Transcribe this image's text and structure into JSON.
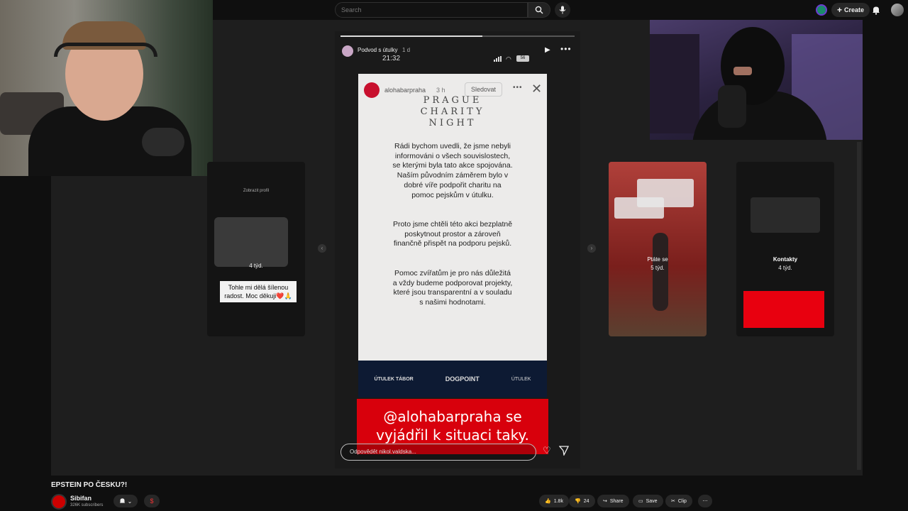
{
  "topbar": {
    "search_placeholder": "Search",
    "create_label": "Create"
  },
  "story": {
    "header_title": "Podvod s útulky",
    "header_age": "1 d",
    "time": "21:32",
    "battery": "56",
    "inner_account": "alohabarpraha",
    "inner_age": "3 h",
    "follow_label": "Sledovat",
    "heading_lines": [
      "PRAGUE",
      "CHARITY",
      "NIGHT"
    ],
    "paragraphs": [
      "Rádi bychom uvedli, že jsme nebyli informováni o všech souvislostech, se kterými byla tato akce spojována. Naším původním záměrem bylo v dobré víře podpořit charitu na pomoc pejskům v útulku.",
      "Proto jsme chtěli této akci bezplatně poskytnout prostor a zároveň finančně přispět na podporu pejsků.",
      "Pomoc zvířatům je pro nás důležitá a vždy budeme podporovat projekty, které jsou transparentní a v souladu s našimi hodnotami."
    ],
    "logos": [
      "ÚTULEK TÁBOR",
      "DOGPOINT",
      "ÚTULEK"
    ],
    "banner_line1": "@alohabarpraha se",
    "banner_line2": "vyjádřil k situaci taky.",
    "reply_placeholder": "Odpovědět nikol.valdska..."
  },
  "side_stories": {
    "left_label": "Zobrazit profil",
    "left_age": "4 týd.",
    "left_caption": "Tohle mi dělá šílenou radost. Moc děkuji❤️🙏",
    "right1_title": "Ptáte se",
    "right1_age": "5 týd.",
    "right2_title": "Kontakty",
    "right2_age": "4 týd."
  },
  "video_info": {
    "title": "EPSTEIN PO ČESKU?!",
    "channel": "Sibifan",
    "subscribers": "326K subscribers",
    "likes": "1.8k",
    "dislikes": "24",
    "share_label": "Share",
    "save_label": "Save",
    "clip_label": "Clip"
  },
  "colors": {
    "accent_red": "#d8000c",
    "background": "#0f0f0f"
  }
}
